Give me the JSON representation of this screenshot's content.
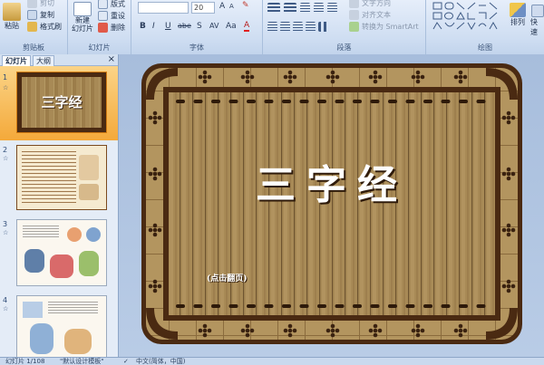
{
  "ribbon": {
    "clipboard": {
      "paste": "粘贴",
      "cut": "剪切",
      "copy": "复制",
      "format_painter": "格式刷",
      "group": "剪贴板"
    },
    "slides": {
      "new_slide": "新建\n幻灯片",
      "layout": "版式",
      "reset": "重设",
      "delete": "删除",
      "group": "幻灯片"
    },
    "font": {
      "font_size": "20",
      "bold": "B",
      "italic": "I",
      "underline": "U",
      "strike": "abe",
      "shadow": "S",
      "spacing": "AV",
      "case": "Aa",
      "color": "A",
      "group": "字体"
    },
    "paragraph": {
      "text_direction": "文字方向",
      "align_text": "对齐文本",
      "smartart": "转换为 SmartArt",
      "group": "段落"
    },
    "drawing": {
      "arrange": "排列",
      "quick_styles": "快速",
      "group": "绘图"
    }
  },
  "panel": {
    "tab_slides": "幻灯片",
    "tab_outline": "大纲",
    "close": "×",
    "slides": [
      {
        "num": "1",
        "title": "三字经"
      },
      {
        "num": "2"
      },
      {
        "num": "3"
      },
      {
        "num": "4"
      }
    ]
  },
  "slide": {
    "title": "三字经",
    "caption": "(点击翻页)"
  },
  "status": {
    "slide_count": "幻灯片 1/108",
    "theme": "\"默认设计模板\"",
    "language": "中文(简体，中国)"
  },
  "colors": {
    "frame_dark": "#4a2a12",
    "wood": "#a88a56",
    "selection": "#f7b23f"
  }
}
